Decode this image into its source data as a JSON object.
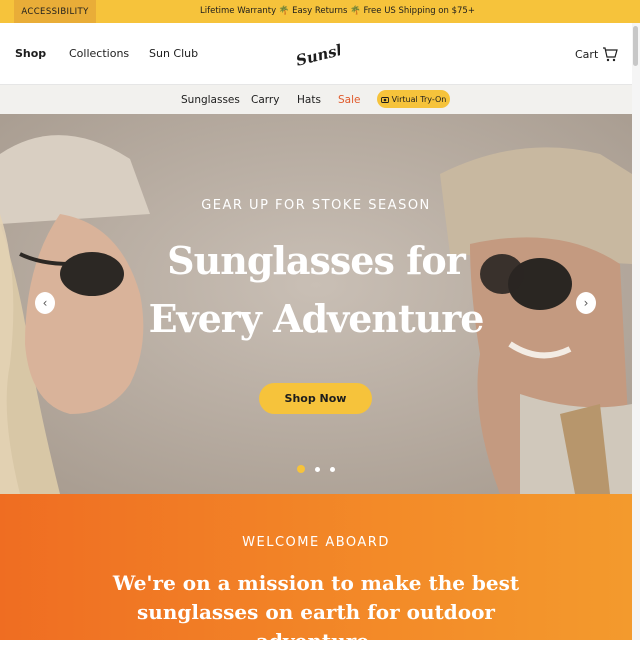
{
  "topbar": {
    "accessibility_label": "ACCESSIBILITY",
    "promo_items": [
      "Lifetime Warranty",
      "Easy Returns",
      "Free US Shipping on $75+"
    ],
    "separator_icon": "palm-tree-icon"
  },
  "header": {
    "nav": [
      "Shop",
      "Collections",
      "Sun Club"
    ],
    "logo_text": "Sunski",
    "cart_label": "Cart",
    "cart_icon": "cart-icon"
  },
  "subnav": {
    "items": [
      "Sunglasses",
      "Carry",
      "Hats",
      "Sale"
    ],
    "tryon_label": "Virtual Try-On",
    "tryon_icon": "camera-icon"
  },
  "hero": {
    "eyebrow": "GEAR UP FOR STOKE SEASON",
    "title_line1": "Sunglasses for",
    "title_line2": "Every Adventure",
    "cta": "Shop Now",
    "slides_total": 3,
    "active_slide": 1
  },
  "welcome": {
    "eyebrow": "WELCOME ABOARD",
    "body": "We're on a mission to make the best sunglasses on earth for outdoor adventure."
  },
  "colors": {
    "brand_yellow": "#f6c33b",
    "sale_red": "#e05a2b",
    "welcome_orange": "#ef6d22"
  }
}
